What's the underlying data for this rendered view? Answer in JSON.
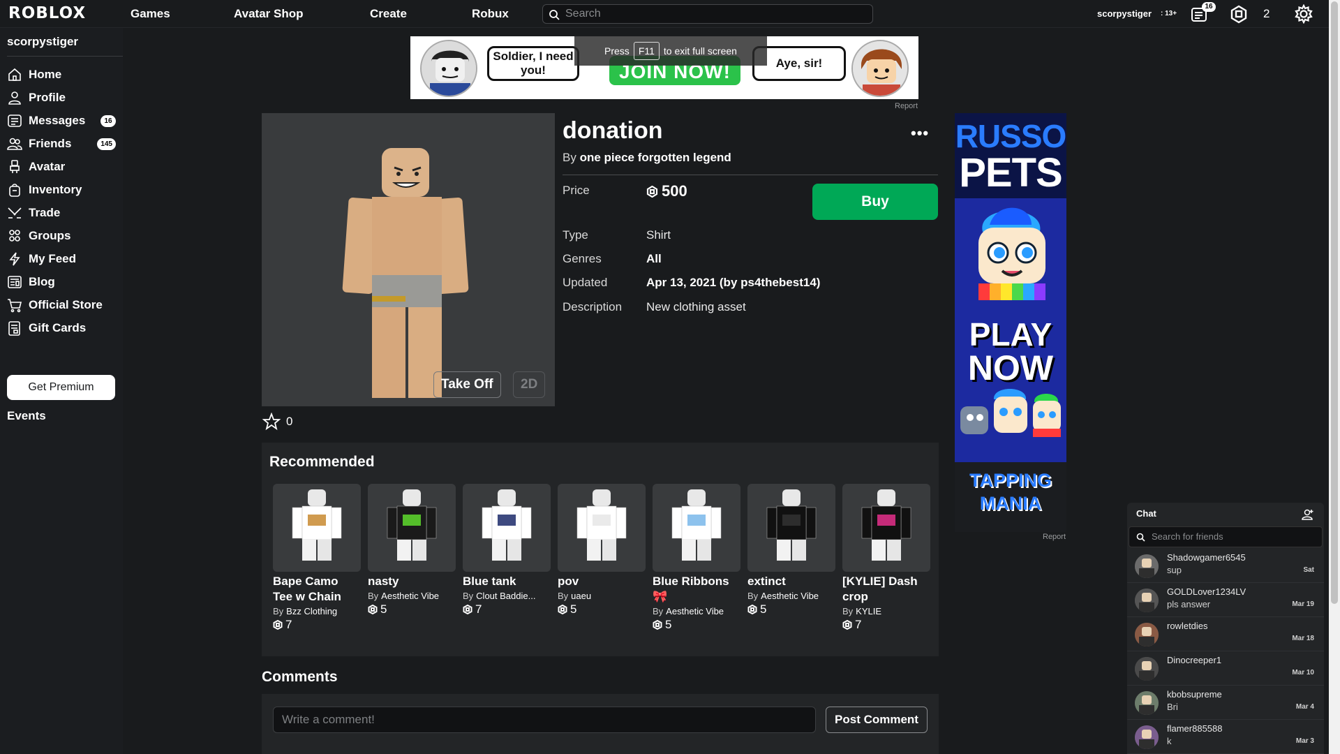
{
  "topbar": {
    "logo": "ROBLOX",
    "nav": [
      "Games",
      "Avatar Shop",
      "Create",
      "Robux"
    ],
    "search_placeholder": "Search",
    "username": "scorpystiger",
    "age_label": ": 13+",
    "notifications_count": "16",
    "robux": "2"
  },
  "sidebar": {
    "username": "scorpystiger",
    "items": [
      {
        "label": "Home",
        "icon": "home-icon"
      },
      {
        "label": "Profile",
        "icon": "profile-icon"
      },
      {
        "label": "Messages",
        "icon": "messages-icon",
        "badge": "16"
      },
      {
        "label": "Friends",
        "icon": "friends-icon",
        "badge": "145"
      },
      {
        "label": "Avatar",
        "icon": "avatar-icon"
      },
      {
        "label": "Inventory",
        "icon": "inventory-icon"
      },
      {
        "label": "Trade",
        "icon": "trade-icon"
      },
      {
        "label": "Groups",
        "icon": "groups-icon"
      },
      {
        "label": "My Feed",
        "icon": "feed-icon"
      },
      {
        "label": "Blog",
        "icon": "blog-icon"
      },
      {
        "label": "Official Store",
        "icon": "cart-icon"
      },
      {
        "label": "Gift Cards",
        "icon": "gift-card-icon"
      }
    ],
    "premium_label": "Get Premium",
    "events_label": "Events"
  },
  "banner_ad": {
    "bubble_left": "Soldier, I need you!",
    "cta": "JOIN NOW!",
    "bubble_right": "Aye, sir!",
    "report": "Report"
  },
  "fullscreen_toast": {
    "before": "Press",
    "key": "F11",
    "after": "to exit full screen"
  },
  "item": {
    "title": "donation",
    "by_prefix": "By",
    "creator": "one piece forgotten legend",
    "price_label": "Price",
    "price": "500",
    "buy_label": "Buy",
    "type_label": "Type",
    "type": "Shirt",
    "genres_label": "Genres",
    "genres": "All",
    "updated_label": "Updated",
    "updated": "Apr 13, 2021 (by ps4thebest14)",
    "description_label": "Description",
    "description": "New clothing asset",
    "take_off_label": "Take Off",
    "view_2d_label": "2D",
    "favorites": "0",
    "more_label": "•••"
  },
  "recommended": {
    "title": "Recommended",
    "by_prefix": "By",
    "items": [
      {
        "name": "Bape Camo Tee w Chain",
        "creator": "Bzz Clothing",
        "price": "7",
        "color": "#ffffff",
        "accent": "#c88a30"
      },
      {
        "name": "nasty",
        "creator": "Aesthetic Vibe",
        "price": "5",
        "color": "#1a1a1a",
        "accent": "#5fdc2e"
      },
      {
        "name": "Blue tank",
        "creator": "Clout Baddie...",
        "price": "7",
        "color": "#ffffff",
        "accent": "#1c2a6a"
      },
      {
        "name": "pov",
        "creator": "uaeu",
        "price": "5",
        "color": "#ffffff",
        "accent": "#e6e6e6"
      },
      {
        "name": "Blue Ribbons 🎀",
        "creator": "Aesthetic Vibe",
        "price": "5",
        "color": "#ffffff",
        "accent": "#79b7ea"
      },
      {
        "name": "extinct",
        "creator": "Aesthetic Vibe",
        "price": "5",
        "color": "#111111",
        "accent": "#333333"
      },
      {
        "name": "[KYLIE] Dash crop",
        "creator": "KYLIE",
        "price": "7",
        "color": "#111111",
        "accent": "#e5308c"
      }
    ]
  },
  "comments": {
    "title": "Comments",
    "placeholder": "Write a comment!",
    "post_label": "Post Comment"
  },
  "side_ad": {
    "line1": "RUSSO",
    "line2": "PETS",
    "play": "PLAY",
    "now": "NOW",
    "game": "TAPPING MANIA",
    "report": "Report"
  },
  "chat": {
    "title": "Chat",
    "search_placeholder": "Search for friends",
    "conversations": [
      {
        "name": "Shadowgamer6545",
        "message": "sup",
        "date": "Sat",
        "avatar_color": "#6b6b6b"
      },
      {
        "name": "GOLDLover1234LV",
        "message": "pls answer",
        "date": "Mar 19",
        "avatar_color": "#555555"
      },
      {
        "name": "rowletdies",
        "message": "",
        "date": "Mar 18",
        "avatar_color": "#8a5a44"
      },
      {
        "name": "Dinocreeper1",
        "message": "",
        "date": "Mar 10",
        "avatar_color": "#4a4a4a"
      },
      {
        "name": "kbobsupreme",
        "message": "Bri",
        "date": "Mar 4",
        "avatar_color": "#6d7d6b"
      },
      {
        "name": "flamer885588",
        "message": "k",
        "date": "Mar 3",
        "avatar_color": "#7a5d8e"
      }
    ]
  },
  "colors": {
    "background": "#191b1d",
    "panel": "#232527",
    "buy_green": "#00a856",
    "ad_blue": "#1c2aa0"
  }
}
